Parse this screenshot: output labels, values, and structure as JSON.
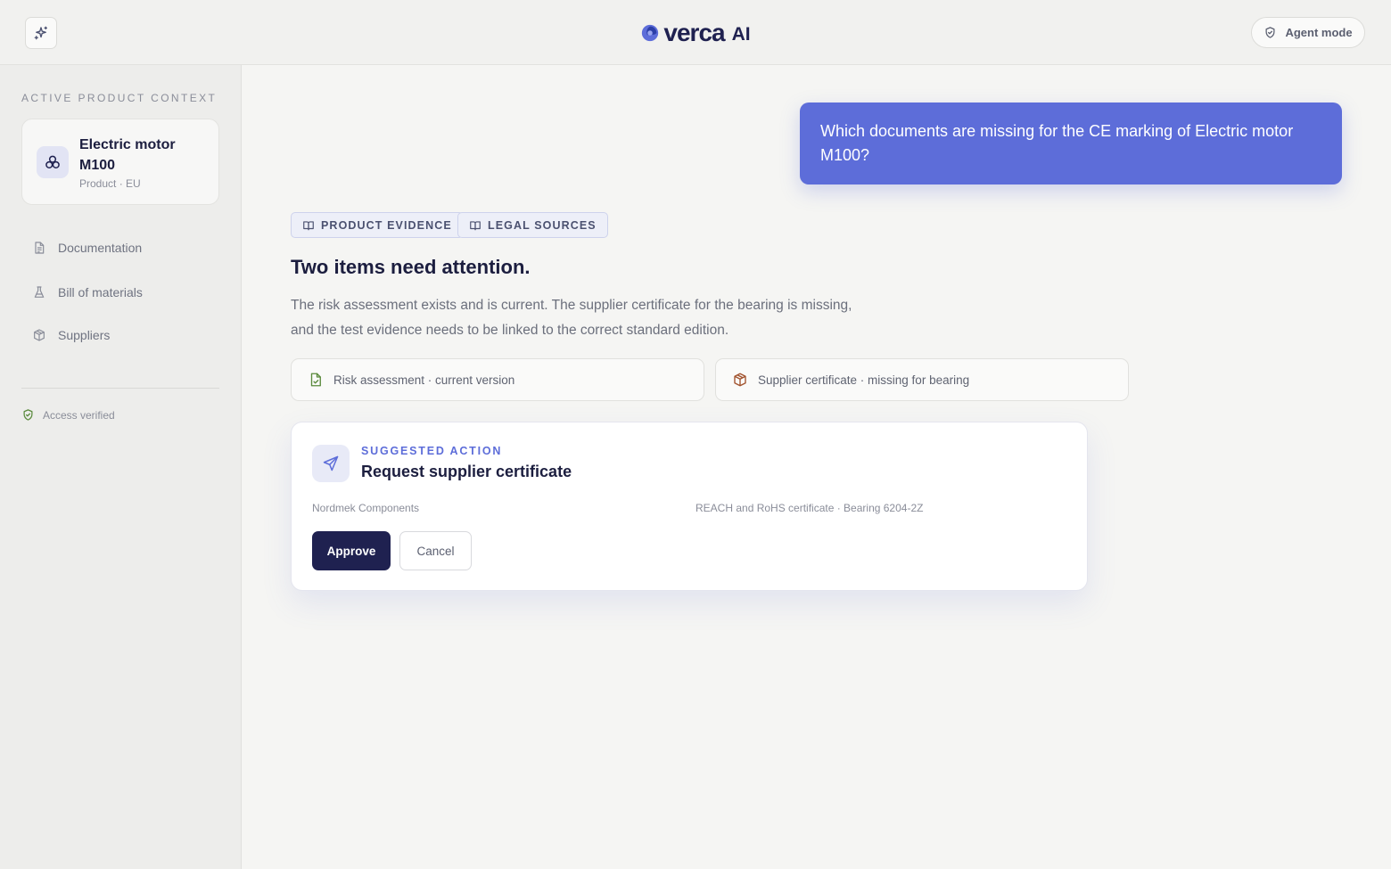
{
  "header": {
    "logo_word": "verca",
    "logo_suffix": "AI",
    "agent_mode_label": "Agent mode"
  },
  "sidebar": {
    "heading": "ACTIVE PRODUCT CONTEXT",
    "product": {
      "name": "Electric motor M100",
      "meta": "Product · EU"
    },
    "nav": [
      {
        "label": "Documentation",
        "icon": "document-icon"
      },
      {
        "label": "Bill of materials",
        "icon": "flask-icon"
      },
      {
        "label": "Suppliers",
        "icon": "package-icon"
      }
    ],
    "access_label": "Access verified"
  },
  "conversation": {
    "user_message": "Which documents are missing for the CE marking of Electric motor M100?",
    "source_chips": [
      "PRODUCT EVIDENCE",
      "LEGAL SOURCES"
    ],
    "answer_title": "Two items need attention.",
    "answer_body": "The risk assessment exists and is current. The supplier certificate for the bearing is missing, and the test evidence needs to be linked to the correct standard edition.",
    "status_items": [
      {
        "label": "Risk assessment · current version",
        "icon": "document-check-icon",
        "color": "#5a8a3c"
      },
      {
        "label": "Supplier certificate · missing for bearing",
        "icon": "package-alert-icon",
        "color": "#a1522d"
      }
    ],
    "action": {
      "eyebrow": "SUGGESTED ACTION",
      "title": "Request supplier certificate",
      "supplier": "Nordmek Components",
      "document": "REACH and RoHS certificate · Bearing 6204-2Z",
      "approve_label": "Approve",
      "cancel_label": "Cancel"
    }
  },
  "colors": {
    "accent": "#5d6dd9",
    "navy": "#1f2150"
  }
}
